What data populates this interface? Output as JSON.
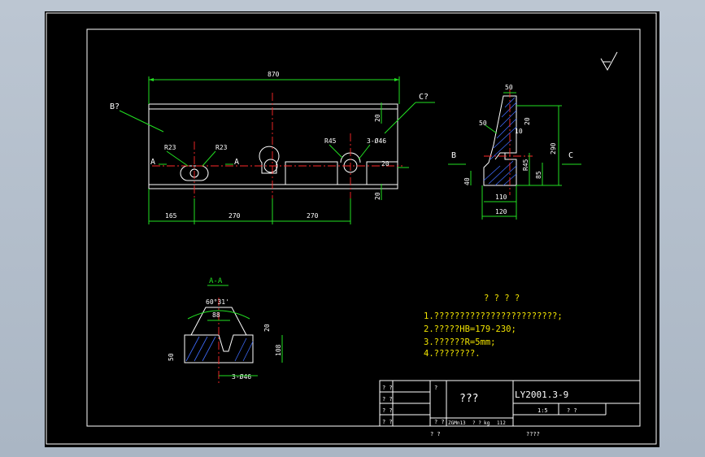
{
  "dims": {
    "overall_length": "870",
    "pos_165": "165",
    "pos_270a": "270",
    "pos_270b": "270",
    "h_20_top": "20",
    "h_20_mid": "20",
    "h_20_bot": "20",
    "r23_left": "R23",
    "r23_right": "R23",
    "r45": "R45",
    "holes": "3-Ø46",
    "section_a_left": "A",
    "section_a_right": "A",
    "view_b": "B?",
    "view_c": "C?"
  },
  "side_view": {
    "top_width": "50",
    "chamfer": "50",
    "small_10": "10",
    "small_20": "20",
    "height_290": "290",
    "r45": "R45",
    "dim_85": "85",
    "dim_40": "40",
    "width_110": "110",
    "width_120": "120",
    "arrow_b": "B",
    "arrow_c": "C"
  },
  "section_aa": {
    "title": "A-A",
    "angle": "60°31'",
    "width_88": "88",
    "h_20": "20",
    "h_108": "108",
    "h_50": "50",
    "holes": "3-Ø46"
  },
  "notes": {
    "heading": "? ? ? ?",
    "line1": "1.????????????????????????;",
    "line2": "2.?????HB=179-230;",
    "line3": "3.??????R=5mm;",
    "line4": "4.????????."
  },
  "title_block": {
    "part_name": "???",
    "drawing_no": "LY2001.3-9",
    "material": "ZGMn13",
    "scale": "1:5",
    "weight": "112",
    "weight_unit": "kg",
    "cell_q2": "? ?",
    "cell_q1": "?",
    "footer_left": "?   ?",
    "footer_right": "????"
  },
  "colors": {
    "background": "#000000",
    "outline": "#ffffff",
    "dimension": "#22e022",
    "centerline": "#ff2a2a",
    "hatch": "#3f6cff",
    "notes": "#f2e400"
  }
}
